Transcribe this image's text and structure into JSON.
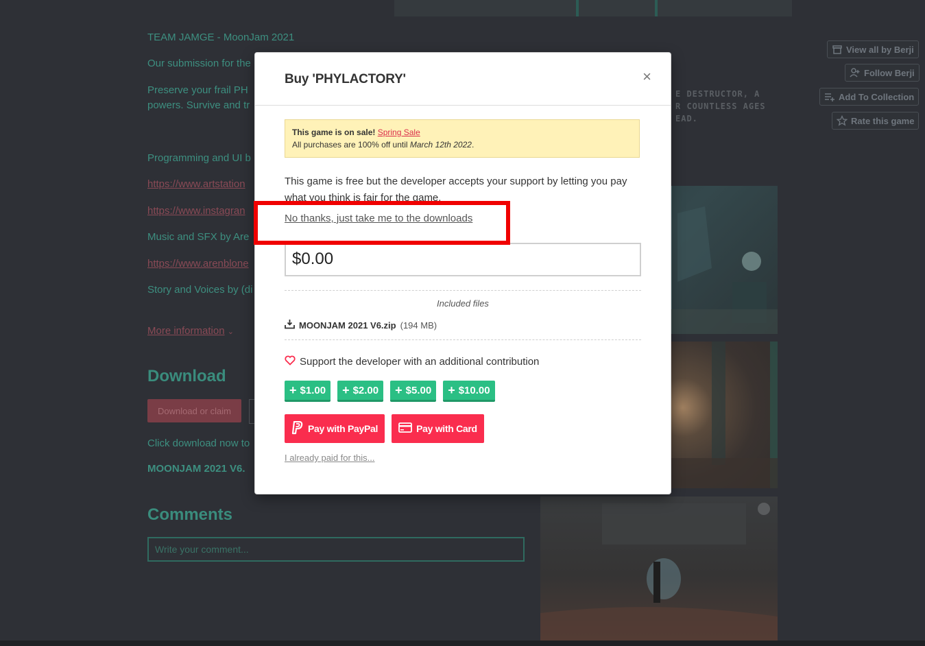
{
  "background": {
    "team_line": "TEAM JAMGE - MoonJam 2021",
    "submission_line": "Our submission for the",
    "preserve_line1": "Preserve your frail PH",
    "preserve_line2": "powers. Survive and tr",
    "programming_line": "Programming and UI b",
    "link1": "https://www.artstation",
    "link2": "https://www.instagran",
    "music_line": "Music and SFX by Are",
    "link3": "https://www.arenblone",
    "story_line": "Story and Voices by (di",
    "more_info": "More information",
    "download_heading": "Download",
    "download_button": "Download or claim",
    "click_download": "Click download now to",
    "file_short": "MOONJAM 2021 V6.",
    "comments_heading": "Comments",
    "comment_placeholder": "Write your comment...",
    "side_buttons": {
      "view_all": "View all by Berji",
      "follow": "Follow Berji",
      "add_collection": "Add To Collection",
      "rate": "Rate this game"
    },
    "deco_lines": [
      "E DESTRUCTOR, A",
      "R COUNTLESS AGES",
      "EAD."
    ]
  },
  "modal": {
    "title": "Buy 'PHYLACTORY'",
    "close": "×",
    "sale": {
      "prefix": "This game is on sale!",
      "link": "Spring Sale",
      "line2_prefix": "All purchases are 100% off until",
      "line2_date": "March 12th 2022",
      "line2_suffix": "."
    },
    "free_text": "This game is free but the developer accepts your support by letting you pay what you think is fair for the game.",
    "no_thanks": "No thanks, just take me to the downloads",
    "price_value": "$0.00",
    "included_files_label": "Included files",
    "file": {
      "name": "MOONJAM 2021 V6.zip",
      "size": "(194 MB)"
    },
    "support_text": "Support the developer with an additional contribution",
    "tips": [
      "$1.00",
      "$2.00",
      "$5.00",
      "$10.00"
    ],
    "pay_paypal": "Pay with PayPal",
    "pay_card": "Pay with Card",
    "already_paid": "I already paid for this..."
  },
  "colors": {
    "accent_green": "#2bbf84",
    "pay_red": "#fa2d4e",
    "highlight_red": "#f00000",
    "sale_bg": "#fff2b8"
  }
}
